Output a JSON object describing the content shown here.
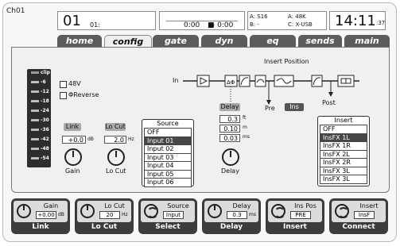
{
  "channel": {
    "label": "Ch01",
    "number": "01",
    "name": "01:"
  },
  "transport": {
    "time_left": "0:00",
    "time_right": "- 0:00"
  },
  "bus": {
    "a1": "A: S16",
    "b1": "B:   -",
    "a2": "A: 48K",
    "c2": "C: X-USB"
  },
  "clock": {
    "hm": "14:11",
    "sec": ":37"
  },
  "tabs": [
    "home",
    "config",
    "gate",
    "dyn",
    "eq",
    "sends",
    "main"
  ],
  "active_tab": "config",
  "config": {
    "phantom_label": "48V",
    "reverse_label": "ΦReverse",
    "meter_labels": [
      "clip",
      "-6",
      "-12",
      "-18",
      "-24",
      "-30",
      "-36",
      "-42",
      "-48",
      "-54"
    ],
    "link_label": "Link",
    "gain_value": "+0.0",
    "gain_unit": "dB",
    "gain_label": "Gain",
    "locut_label": "Lo Cut",
    "locut_value": "2.0",
    "locut_unit": "Hz",
    "locut_knob_label": "Lo Cut",
    "source_title": "Source",
    "source_items": [
      "OFF",
      "Input 01",
      "Input 02",
      "Input 03",
      "Input 04",
      "Input 05",
      "Input 06"
    ],
    "source_selected": 1,
    "delay_label": "Delay",
    "delay_values": [
      {
        "value": "0.3",
        "unit": "ft"
      },
      {
        "value": "0.10",
        "unit": "m"
      },
      {
        "value": "0.03",
        "unit": "ms"
      }
    ],
    "delay_knob_label": "Delay",
    "insert_position_title": "Insert Position",
    "flow_in": "In",
    "flow_pre": "Pre",
    "flow_ins": "Ins",
    "flow_post": "Post",
    "insert_title": "Insert",
    "insert_items": [
      "OFF",
      "InsFX 1L",
      "InsFX 1R",
      "InsFX 2L",
      "InsFX 2R",
      "InsFX 3L",
      "InsFX 3L"
    ],
    "insert_selected": 1
  },
  "footer": [
    {
      "title": "Gain",
      "value": "+0.00",
      "unit": "dB",
      "label": "Link"
    },
    {
      "title": "Lo Cut",
      "value": "20",
      "unit": "Hz",
      "label": "Lo Cut"
    },
    {
      "title": "Source",
      "value": "Input",
      "unit": "",
      "label": "Select"
    },
    {
      "title": "Delay",
      "value": "0.3",
      "unit": "ms",
      "label": "Delay"
    },
    {
      "title": "Ins Pos",
      "value": "PRE",
      "unit": "",
      "label": "Insert"
    },
    {
      "title": "Insert",
      "value": "InsF",
      "unit": "",
      "label": "Connect"
    }
  ]
}
